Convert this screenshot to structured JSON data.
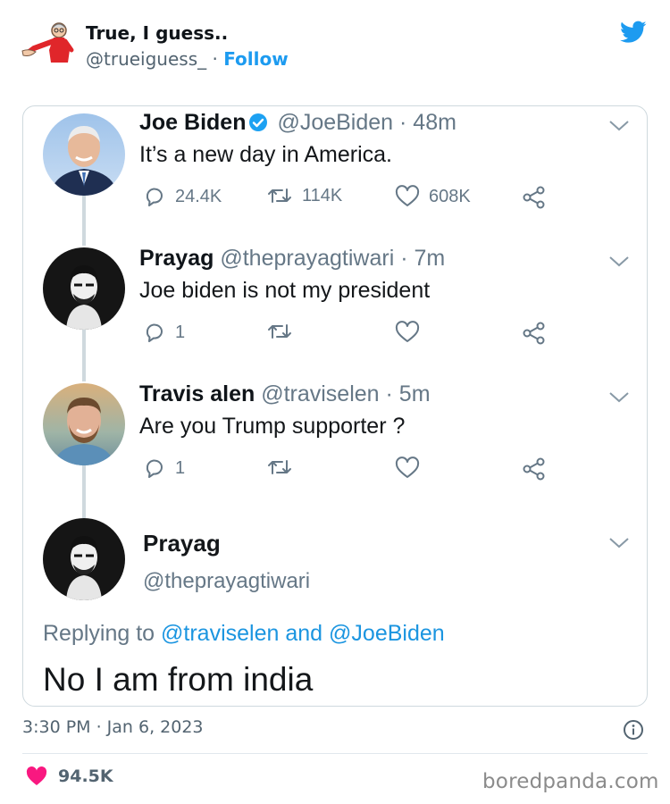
{
  "outer": {
    "name": "True, I guess..",
    "handle": "@trueiguess_",
    "separator": " · ",
    "follow_label": "Follow",
    "timestamp": "3:30 PM · Jan 6, 2023",
    "likes": "94.5K",
    "watermark": "boredpanda.com",
    "icons": [
      "avatar-image",
      "twitter-bird-icon",
      "info-icon",
      "heart-icon"
    ],
    "colors": {
      "accent": "#1d9bf0",
      "heart": "#f91880"
    }
  },
  "thread": [
    {
      "name": "Joe Biden",
      "verified": true,
      "handle": "@JoeBiden",
      "time": "· 48m",
      "text": "It’s a new day in America.",
      "replies": "24.4K",
      "retweets": "114K",
      "likes": "608K"
    },
    {
      "name": "Prayag",
      "handle": "@theprayagtiwari",
      "time": "· 7m",
      "text": "Joe biden is not my president",
      "replies": "1",
      "retweets": "",
      "likes": ""
    },
    {
      "name": "Travis alen",
      "handle": "@traviselen",
      "time": "· 5m",
      "text": "Are you Trump supporter ?",
      "replies": "1",
      "retweets": "",
      "likes": ""
    }
  ],
  "main_reply": {
    "name": "Prayag",
    "handle": "@theprayagtiwari",
    "replying_prefix": "Replying to",
    "mention_1": "@traviselen",
    "conjunction": "and",
    "mention_2": "@JoeBiden",
    "text": "No I am from india"
  }
}
